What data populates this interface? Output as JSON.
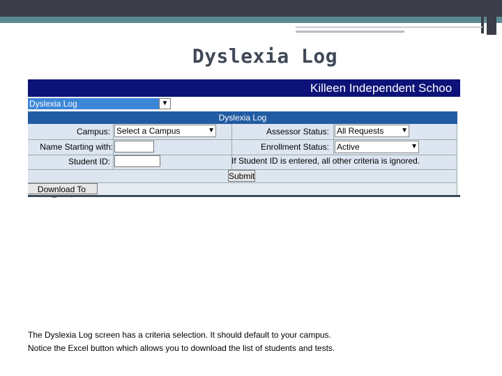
{
  "slide": {
    "title": "Dyslexia Log",
    "caption_line1": "The Dyslexia Log screen has a criteria selection.  It should default to your campus.",
    "caption_line2": "Notice the Excel button which allows you to download the list of students and tests."
  },
  "app": {
    "banner_text": "Killeen Independent Schoo",
    "report_select_value": "Dyslexia Log",
    "form_header": "Dyslexia Log",
    "campus_label": "Campus:",
    "campus_value": "Select a Campus",
    "assessor_label": "Assessor Status:",
    "assessor_value": "All Requests",
    "name_label": "Name Starting with:",
    "name_value": "",
    "enrollment_label": "Enrollment Status:",
    "enrollment_value": "Active",
    "student_id_label": "Student ID:",
    "student_id_value": "",
    "student_id_note": "If Student ID is entered, all other criteria is ignored.",
    "submit_label": "Submit",
    "download_label": "Download To Excel"
  },
  "colors": {
    "banner": "#0c1277",
    "form_header": "#215ca3",
    "row_bg": "#dde5f0",
    "title": "#404856"
  },
  "icons": {
    "dropdown": "chevron-down-icon"
  }
}
